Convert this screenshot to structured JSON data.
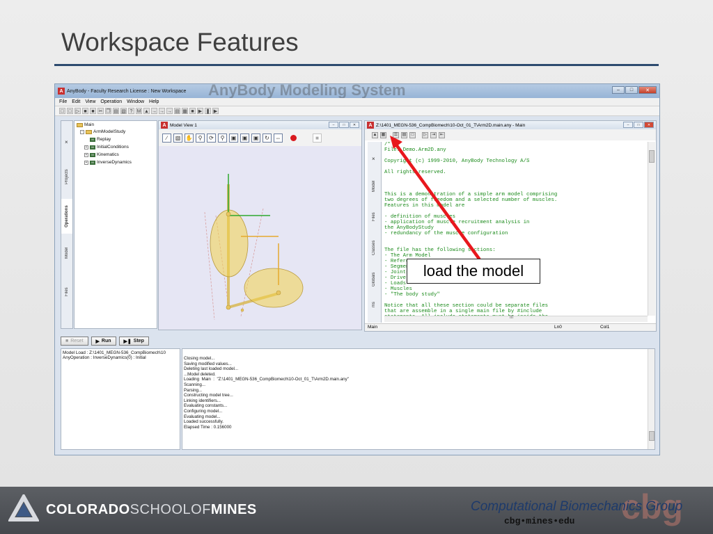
{
  "slide": {
    "title": "Workspace Features"
  },
  "app": {
    "title": "AnyBody  -  Faculty Research License :  New Workspace",
    "watermark": "AnyBody Modeling System",
    "menu": [
      "File",
      "Edit",
      "View",
      "Operation",
      "Window",
      "Help"
    ],
    "window_buttons": {
      "minimize": "–",
      "maximize": "□",
      "close": "✕"
    }
  },
  "left_tabs": {
    "close": "×",
    "projects": "Projects",
    "operations": "Operations",
    "model": "Model",
    "files": "Files"
  },
  "tree": {
    "root": "Main",
    "study": "ArmModelStudy",
    "items": [
      "Replay",
      "InitialConditions",
      "Kinematics",
      "InverseDynamics"
    ],
    "mi_badge": "M"
  },
  "model_view": {
    "title": "Model View 1",
    "icon": "A"
  },
  "editor": {
    "title": "Z:\\1401_MEGN-536_CompBiomech\\10-Oct_01_T\\Arm2D.main.any - Main",
    "icon": "A",
    "side_tabs": {
      "close": "×",
      "model": "Model",
      "files": "Files",
      "classes": "Classes",
      "globals": "Globals",
      "ms": "ms"
    },
    "lines": [
      "/*",
      "File: Demo.Arm2D.any",
      "",
      "Copyright (c) 1999-2010, AnyBody Technology A/S",
      "",
      "All rights reserved.",
      "",
      "",
      "",
      "This is a demonstration of a simple arm model comprising",
      "two degrees of freedom and a selected number of muscles.",
      "Features in this model are",
      "",
      "- definition of muscles",
      "- application of muscle recruitment analysis in",
      "the AnyBodyStudy",
      "- redundancy of the muscle configuration",
      "",
      "",
      "The file has the following sections:",
      "- The Arm Model",
      "- References",
      "- Segments",
      "- Joints",
      "- Drivers",
      "- Loads",
      "- Muscles",
      "- \"The body study\"",
      "",
      "Notice that all these section could be separate files",
      "that are assemble in a single main file by #include",
      "statements. All include statements must be inside the"
    ],
    "status": {
      "left": "Main",
      "ln": "Ln0",
      "col": "Col1"
    },
    "hscroll_mark": "III"
  },
  "run_bar": {
    "reset": "Reset",
    "run": "Run",
    "step": "Step"
  },
  "operations": {
    "lines": [
      "Model Load : Z:\\1401_MEGN-536_CompBiomech\\10",
      "AnyOperation : InverseDynamics(0) : Initial"
    ]
  },
  "log": {
    "lines": [
      "Closing model...",
      "Saving modified values...",
      "Deleting last loaded model...",
      "...Model deleted.",
      "Loading  Main  :  \"Z:\\1401_MEGN-536_CompBiomech\\10-Oct_01_T\\Arm2D.main.any\"",
      "Scanning...",
      "Parsing...",
      "Constructing model tree...",
      "Linking identifiers...",
      "Evaluating constants...",
      "Configuring model...",
      "Evaluating model...",
      "Loaded successfully.",
      "Elapsed Time : 0.156000"
    ]
  },
  "callout": {
    "text": "load the model"
  },
  "footer": {
    "school_a": "COLORADO",
    "school_b": "SCHOOLOF",
    "school_c": "MINES",
    "group": "Computational Biomechanics Group",
    "url": "cbg•mines•edu",
    "mark": "cbg"
  },
  "colors": {
    "title_rule": "#2d4b6f",
    "code_text": "#1a8a1a",
    "arrow": "#e8181d",
    "footer": "#4f5257"
  }
}
